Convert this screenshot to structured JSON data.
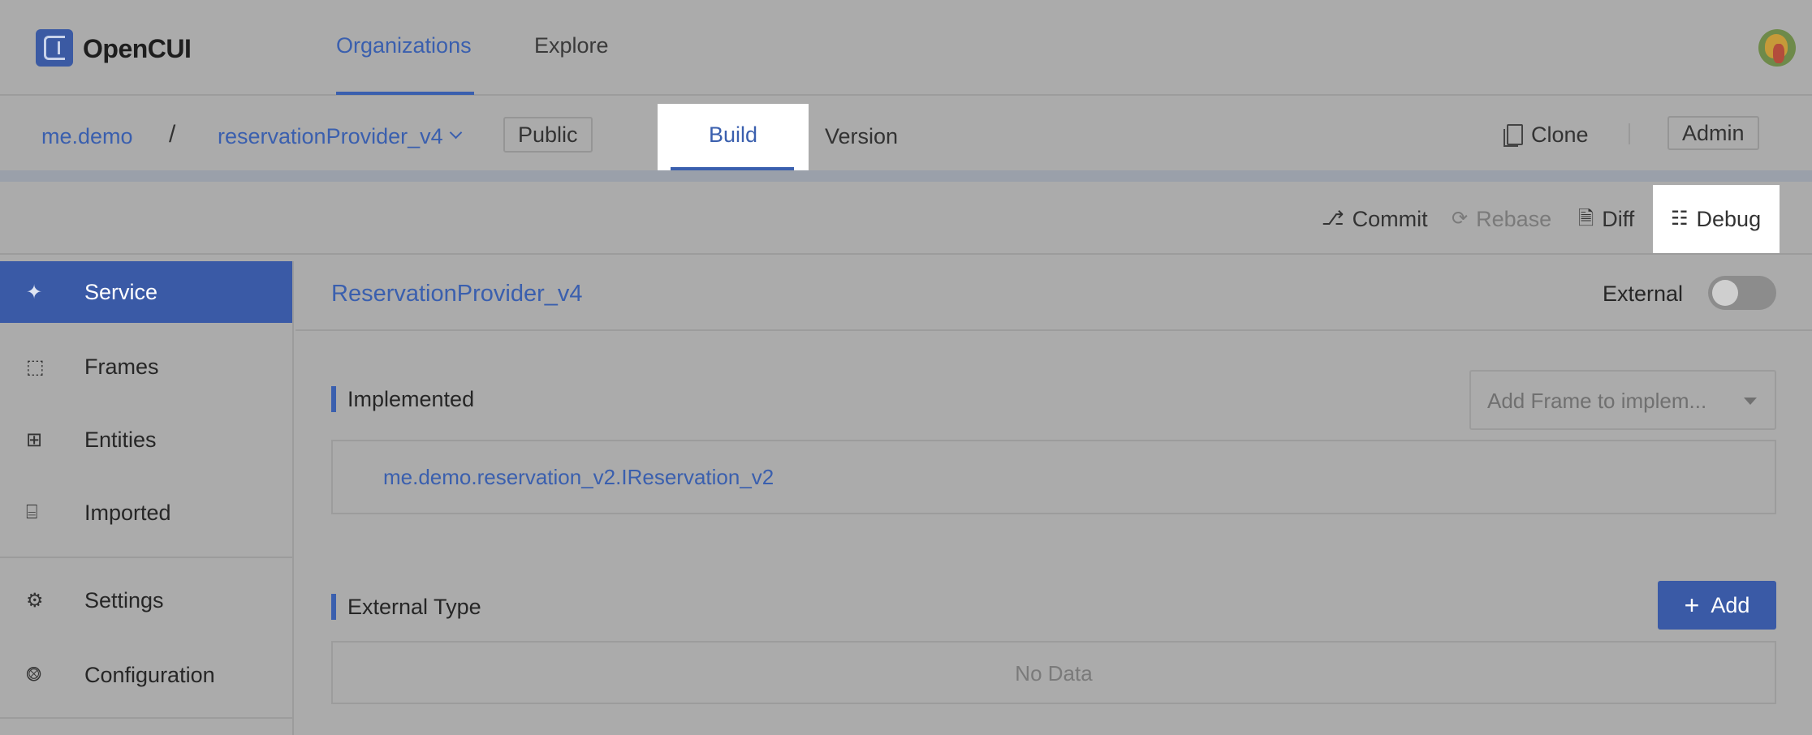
{
  "header": {
    "brand": "OpenCUI",
    "nav": {
      "organizations": "Organizations",
      "explore": "Explore"
    }
  },
  "project_bar": {
    "org": "me.demo",
    "separator": "/",
    "project": "reservationProvider_v4",
    "visibility": "Public",
    "tabs": {
      "build": "Build",
      "version": "Version"
    },
    "clone": "Clone",
    "admin": "Admin"
  },
  "toolbar": {
    "commit": "Commit",
    "rebase": "Rebase",
    "diff": "Diff",
    "debug": "Debug"
  },
  "sidebar": {
    "items": [
      {
        "label": "Service",
        "icon": "plug-icon",
        "active": true
      },
      {
        "label": "Frames",
        "icon": "frames-icon"
      },
      {
        "label": "Entities",
        "icon": "entities-icon"
      },
      {
        "label": "Imported",
        "icon": "imported-icon"
      },
      {
        "label": "Settings",
        "icon": "gear-icon"
      },
      {
        "label": "Configuration",
        "icon": "config-icon"
      }
    ]
  },
  "main": {
    "title": "ReservationProvider_v4",
    "external_label": "External",
    "external_on": false,
    "implemented": {
      "label": "Implemented",
      "select_placeholder": "Add Frame to implem...",
      "items": [
        "me.demo.reservation_v2.IReservation_v2"
      ]
    },
    "external_type": {
      "label": "External Type",
      "add_label": "Add",
      "empty_text": "No Data"
    }
  },
  "colors": {
    "accent": "#3a5fae",
    "overlay_bg": "#ababab",
    "highlight": "#ffffff"
  }
}
